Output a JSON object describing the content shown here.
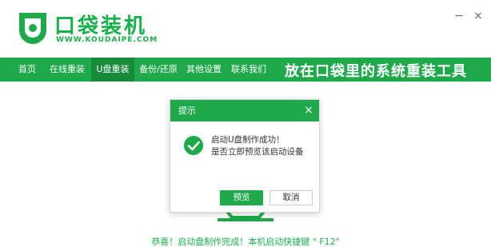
{
  "app": {
    "brand": "口袋装机",
    "url": "WWW.KOUDAIPE.COM",
    "accent_color": "#1ea94a",
    "window_buttons": {
      "minimize_icon": "minimize-icon",
      "minimize": "−",
      "close_icon": "close-icon",
      "close": "×"
    }
  },
  "nav": {
    "items": [
      {
        "label": "首页"
      },
      {
        "label": "在线重装"
      },
      {
        "label": "U盘重装",
        "active": true
      },
      {
        "label": "备份/还原"
      },
      {
        "label": "其他设置"
      },
      {
        "label": "联系我们"
      }
    ],
    "slogan": "放在口袋里的系统重装工具"
  },
  "dialog": {
    "title": "提示",
    "close": "×",
    "message_line1": "启动U盘制作成功！",
    "message_line2": "是否立即预览该启动设备",
    "preview_button": "预览",
    "cancel_button": "取消"
  },
  "status": {
    "bottom_message": "恭喜！启动盘制作完成！本机启动快捷键 \" F12\""
  }
}
